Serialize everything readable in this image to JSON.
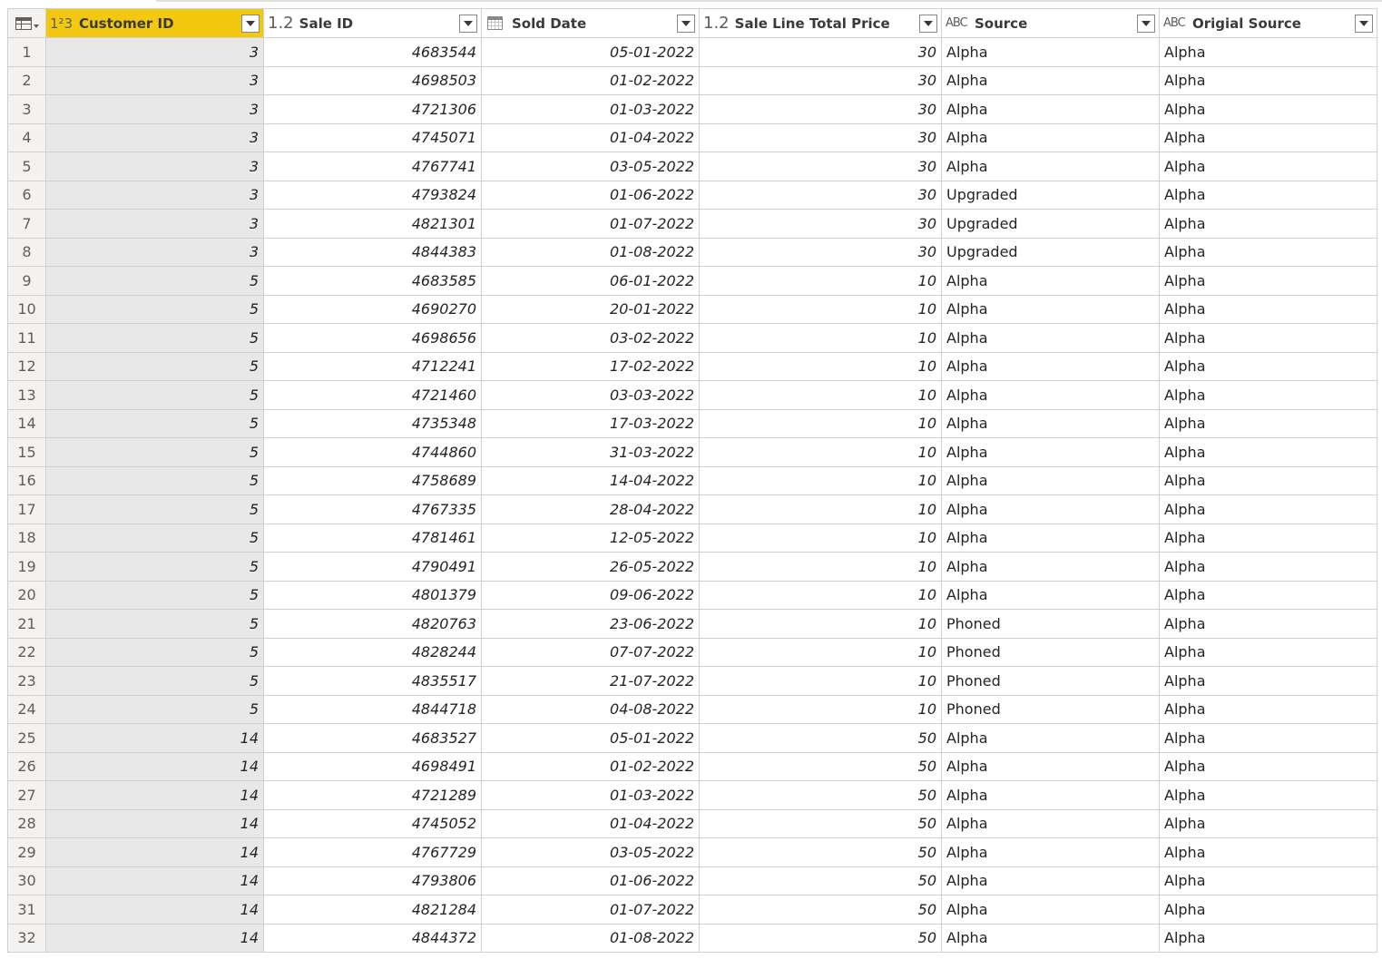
{
  "columns": [
    {
      "name": "Customer ID",
      "type_icon": "1²3",
      "icon_name": "whole-number-type-icon"
    },
    {
      "name": "Sale ID",
      "type_icon": "1.2",
      "icon_name": "decimal-type-icon"
    },
    {
      "name": "Sold Date",
      "type_icon": "",
      "icon_name": "date-type-icon"
    },
    {
      "name": "Sale Line Total Price",
      "type_icon": "1.2",
      "icon_name": "decimal-type-icon"
    },
    {
      "name": "Source",
      "type_icon": "ABC",
      "icon_name": "text-type-icon"
    },
    {
      "name": "Origial Source",
      "type_icon": "ABC",
      "icon_name": "text-type-icon"
    }
  ],
  "rows": [
    [
      "1",
      "3",
      "4683544",
      "05-01-2022",
      "30",
      "Alpha",
      "Alpha"
    ],
    [
      "2",
      "3",
      "4698503",
      "01-02-2022",
      "30",
      "Alpha",
      "Alpha"
    ],
    [
      "3",
      "3",
      "4721306",
      "01-03-2022",
      "30",
      "Alpha",
      "Alpha"
    ],
    [
      "4",
      "3",
      "4745071",
      "01-04-2022",
      "30",
      "Alpha",
      "Alpha"
    ],
    [
      "5",
      "3",
      "4767741",
      "03-05-2022",
      "30",
      "Alpha",
      "Alpha"
    ],
    [
      "6",
      "3",
      "4793824",
      "01-06-2022",
      "30",
      "Upgraded",
      "Alpha"
    ],
    [
      "7",
      "3",
      "4821301",
      "01-07-2022",
      "30",
      "Upgraded",
      "Alpha"
    ],
    [
      "8",
      "3",
      "4844383",
      "01-08-2022",
      "30",
      "Upgraded",
      "Alpha"
    ],
    [
      "9",
      "5",
      "4683585",
      "06-01-2022",
      "10",
      "Alpha",
      "Alpha"
    ],
    [
      "10",
      "5",
      "4690270",
      "20-01-2022",
      "10",
      "Alpha",
      "Alpha"
    ],
    [
      "11",
      "5",
      "4698656",
      "03-02-2022",
      "10",
      "Alpha",
      "Alpha"
    ],
    [
      "12",
      "5",
      "4712241",
      "17-02-2022",
      "10",
      "Alpha",
      "Alpha"
    ],
    [
      "13",
      "5",
      "4721460",
      "03-03-2022",
      "10",
      "Alpha",
      "Alpha"
    ],
    [
      "14",
      "5",
      "4735348",
      "17-03-2022",
      "10",
      "Alpha",
      "Alpha"
    ],
    [
      "15",
      "5",
      "4744860",
      "31-03-2022",
      "10",
      "Alpha",
      "Alpha"
    ],
    [
      "16",
      "5",
      "4758689",
      "14-04-2022",
      "10",
      "Alpha",
      "Alpha"
    ],
    [
      "17",
      "5",
      "4767335",
      "28-04-2022",
      "10",
      "Alpha",
      "Alpha"
    ],
    [
      "18",
      "5",
      "4781461",
      "12-05-2022",
      "10",
      "Alpha",
      "Alpha"
    ],
    [
      "19",
      "5",
      "4790491",
      "26-05-2022",
      "10",
      "Alpha",
      "Alpha"
    ],
    [
      "20",
      "5",
      "4801379",
      "09-06-2022",
      "10",
      "Alpha",
      "Alpha"
    ],
    [
      "21",
      "5",
      "4820763",
      "23-06-2022",
      "10",
      "Phoned",
      "Alpha"
    ],
    [
      "22",
      "5",
      "4828244",
      "07-07-2022",
      "10",
      "Phoned",
      "Alpha"
    ],
    [
      "23",
      "5",
      "4835517",
      "21-07-2022",
      "10",
      "Phoned",
      "Alpha"
    ],
    [
      "24",
      "5",
      "4844718",
      "04-08-2022",
      "10",
      "Phoned",
      "Alpha"
    ],
    [
      "25",
      "14",
      "4683527",
      "05-01-2022",
      "50",
      "Alpha",
      "Alpha"
    ],
    [
      "26",
      "14",
      "4698491",
      "01-02-2022",
      "50",
      "Alpha",
      "Alpha"
    ],
    [
      "27",
      "14",
      "4721289",
      "01-03-2022",
      "50",
      "Alpha",
      "Alpha"
    ],
    [
      "28",
      "14",
      "4745052",
      "01-04-2022",
      "50",
      "Alpha",
      "Alpha"
    ],
    [
      "29",
      "14",
      "4767729",
      "03-05-2022",
      "50",
      "Alpha",
      "Alpha"
    ],
    [
      "30",
      "14",
      "4793806",
      "01-06-2022",
      "50",
      "Alpha",
      "Alpha"
    ],
    [
      "31",
      "14",
      "4821284",
      "01-07-2022",
      "50",
      "Alpha",
      "Alpha"
    ],
    [
      "32",
      "14",
      "4844372",
      "01-08-2022",
      "50",
      "Alpha",
      "Alpha"
    ]
  ],
  "colors": {
    "selected_header": "#f2c811",
    "quality_bar": "#16b3a6",
    "selected_column_cells": "#e8e8e8"
  }
}
